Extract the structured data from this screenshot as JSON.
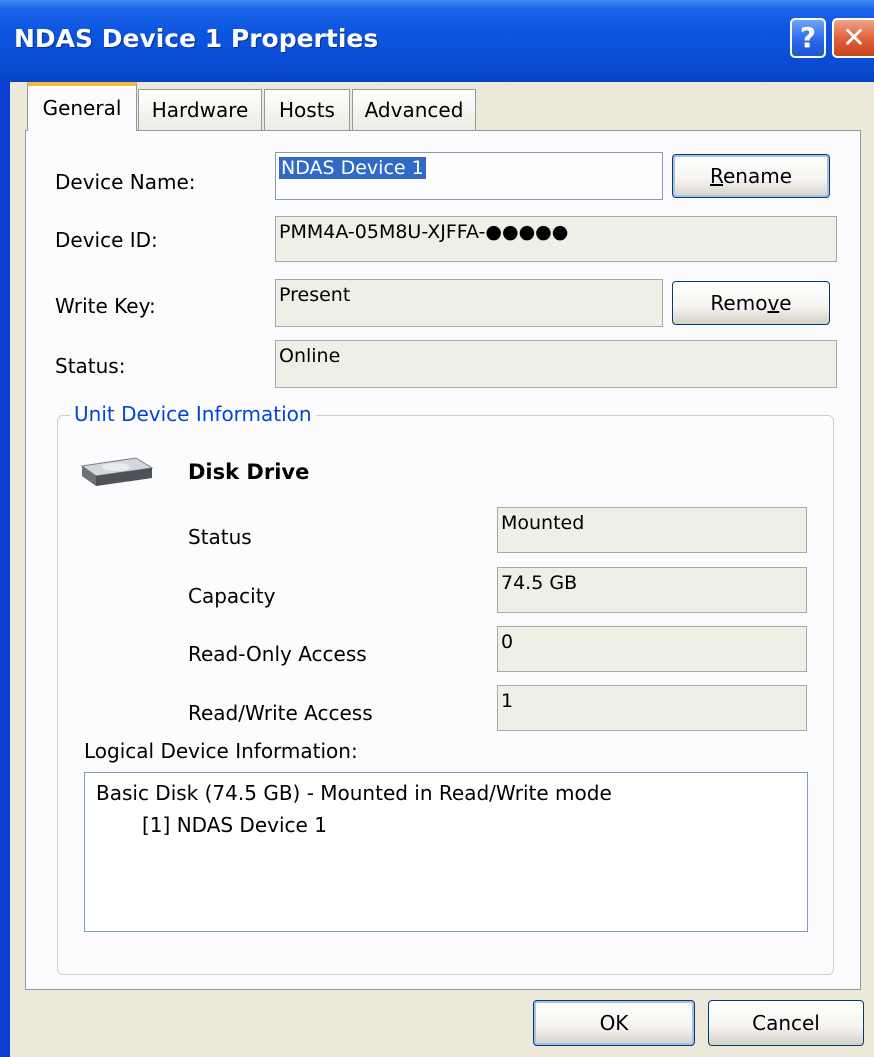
{
  "window": {
    "title": "NDAS Device 1 Properties",
    "help_glyph": "?",
    "close_glyph": "✕"
  },
  "tabs": [
    {
      "label": "General",
      "active": true
    },
    {
      "label": "Hardware",
      "active": false
    },
    {
      "label": "Hosts",
      "active": false
    },
    {
      "label": "Advanced",
      "active": false
    }
  ],
  "general": {
    "device_name_label": "Device Name:",
    "device_name_value": "NDAS Device 1",
    "rename_button": {
      "pre": "",
      "accel": "R",
      "post": "ename"
    },
    "device_id_label": "Device ID:",
    "device_id_value": "PMM4A-05M8U-XJFFA-●●●●●",
    "write_key_label": "Write Key:",
    "write_key_value": "Present",
    "remove_button": {
      "pre": "Remo",
      "accel": "v",
      "post": "e"
    },
    "status_label": "Status:",
    "status_value": "Online"
  },
  "unit_device": {
    "group_title": "Unit Device Information",
    "drive_icon": "disk-drive-icon",
    "drive_title": "Disk Drive",
    "rows": [
      {
        "label": "Status",
        "value": "Mounted"
      },
      {
        "label": "Capacity",
        "value": "74.5 GB"
      },
      {
        "label": "Read-Only Access",
        "value": "0"
      },
      {
        "label": "Read/Write Access",
        "value": "1"
      }
    ],
    "logical_label": "Logical Device Information:",
    "logical_lines": [
      "Basic Disk (74.5 GB) - Mounted in Read/Write mode",
      "[1] NDAS Device 1"
    ]
  },
  "footer": {
    "ok_label": "OK",
    "cancel_label": "Cancel"
  },
  "colors": {
    "titlebar": "#0a4ed6",
    "dialog_bg": "#ece9d8",
    "group_title": "#0046d5",
    "selection": "#316ac5",
    "active_tab_accent": "#f5b940"
  }
}
